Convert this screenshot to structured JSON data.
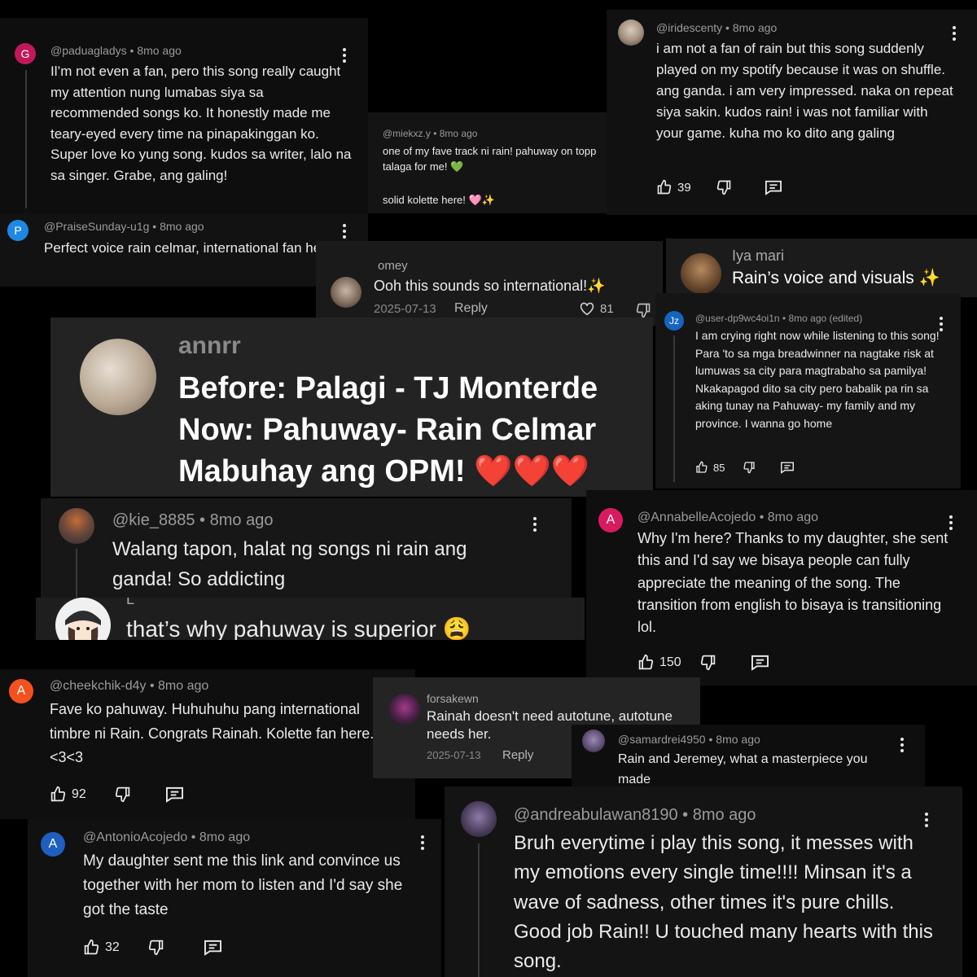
{
  "c1": {
    "avatar_letter": "G",
    "avatar_color": "#c2185b",
    "handle": "@paduagladys",
    "time": "8mo ago",
    "text": "Il’m not even a fan, pero this song really caught my attention nung lumabas siya sa recommended songs ko. It honestly made me teary-eyed every time na pinapakinggan ko. Super love ko yung song. kudos sa writer, lalo na sa singer. Grabe, ang galing!"
  },
  "c2": {
    "avatar_letter": "P",
    "avatar_color": "#1e88e5",
    "handle": "@PraiseSunday-u1g",
    "time": "8mo ago",
    "text": "Perfect voice rain celmar, international fan here"
  },
  "c3": {
    "handle": "@miekxz.y",
    "time": "8mo ago",
    "line1": "one of my fave track ni rain! pahuway on topp talaga for me! 💚",
    "line2": "solid kolette here! 🩷✨"
  },
  "c4": {
    "handle": "@iridescenty",
    "time": "8mo ago",
    "text": "i am not a fan of rain but this song suddenly played on my spotify because it was on shuffle. ang ganda. i am very impressed. naka on repeat siya sakin. kudos rain! i was not familiar with your game. kuha mo ko dito ang galing",
    "likes": "39"
  },
  "c5": {
    "name": "Iya mari",
    "text": "Rain’s voice and visuals ✨"
  },
  "c6": {
    "name": "omey",
    "text": "Ooh this sounds so international!✨",
    "date": "2025-07-13",
    "reply": "Reply",
    "likes": "81"
  },
  "c7": {
    "name": "annrr",
    "line1": "Before: Palagi - TJ Monterde",
    "line2": "Now: Pahuway- Rain Celmar",
    "line3": "Mabuhay ang OPM! ❤️❤️❤️"
  },
  "c8": {
    "avatar_letter": "Jz",
    "avatar_color": "#1565c0",
    "handle": "@user-dp9wc4oi1n",
    "time": "8mo ago (edited)",
    "text": "I am crying right now while listening to this song! Para 'to sa mga breadwinner na nagtake risk at lumuwas sa city para magtrabaho sa pamilya! Nkakapagod dito sa city pero babalik pa rin sa aking tunay na Pahuway- my family and my province. I wanna go home",
    "likes": "85"
  },
  "c9": {
    "handle": "@kie_8885",
    "time": "8mo ago",
    "text": "Walang tapon, halat ng songs ni rain ang ganda! So addicting"
  },
  "c10": {
    "letter": "L",
    "text": "that’s why pahuway is superior 😩"
  },
  "c11": {
    "avatar_letter": "A",
    "avatar_color": "#d81b60",
    "handle": "@AnnabelleAcojedo",
    "time": "8mo ago",
    "text": "Why I'm here? Thanks to my daughter, she sent this and I'd say we bisaya people can fully appreciate the meaning of the song. The transition from english to bisaya is transitioning lol.",
    "likes": "150"
  },
  "c12": {
    "avatar_letter": "A",
    "avatar_color": "#f4511e",
    "handle": "@cheekchik-d4y",
    "time": "8mo ago",
    "text": "Fave ko pahuway. Huhuhuhu pang international timbre ni Rain. Congrats Rainah. Kolette fan here. <3<3",
    "likes": "92"
  },
  "c13": {
    "name": "forsakewn",
    "text": "Rainah doesn't need autotune, autotune needs her.",
    "date": "2025-07-13",
    "reply": "Reply"
  },
  "c14": {
    "handle": "@samardrei4950",
    "time": "8mo ago",
    "text": "Rain and Jeremey, what a masterpiece you made"
  },
  "c15": {
    "avatar_letter": "A",
    "avatar_color": "#1e5fbf",
    "handle": "@AntonioAcojedo",
    "time": "8mo ago",
    "text": "My daughter sent me this link and convince us together with her mom to listen and I'd say she got the taste",
    "likes": "32"
  },
  "c16": {
    "handle": "@andreabulawan8190",
    "time": "8mo ago",
    "text": "Bruh everytime i play this song, it messes with my emotions every single time!!!! Minsan it's a wave of sadness, other times it's pure chills. Good job Rain!! U touched many hearts with this song."
  },
  "sep": "•"
}
